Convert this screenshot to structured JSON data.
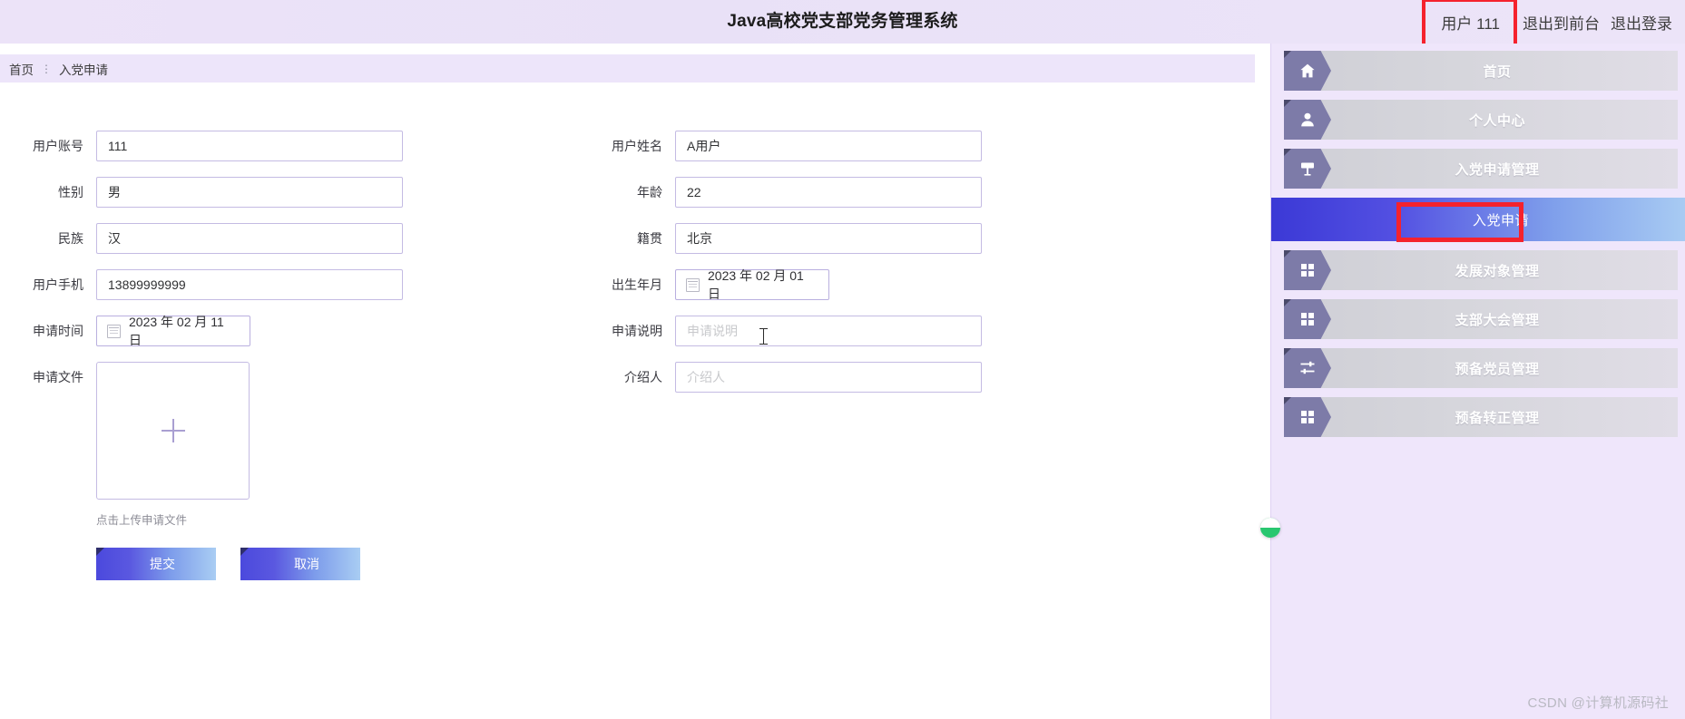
{
  "topbar": {
    "title": "Java高校党支部党务管理系统",
    "user": "用户 111",
    "exit_front": "退出到前台",
    "logout": "退出登录"
  },
  "breadcrumb": {
    "home": "首页",
    "separator": "⋮",
    "current": "入党申请"
  },
  "form": {
    "left": [
      {
        "label": "用户账号",
        "value": "111",
        "placeholder": "用户账号",
        "type": "text"
      },
      {
        "label": "性别",
        "value": "男",
        "placeholder": "性别",
        "type": "text"
      },
      {
        "label": "民族",
        "value": "汉",
        "placeholder": "民族",
        "type": "text"
      },
      {
        "label": "用户手机",
        "value": "13899999999",
        "placeholder": "用户手机",
        "type": "text"
      },
      {
        "label": "申请时间",
        "value": "2023 年 02 月 11 日",
        "type": "date"
      }
    ],
    "right": [
      {
        "label": "用户姓名",
        "value": "A用户",
        "placeholder": "用户姓名",
        "type": "text"
      },
      {
        "label": "年龄",
        "value": "22",
        "placeholder": "年龄",
        "type": "text"
      },
      {
        "label": "籍贯",
        "value": "北京",
        "placeholder": "籍贯",
        "type": "text"
      },
      {
        "label": "出生年月",
        "value": "2023 年 02 月 01 日",
        "type": "date"
      },
      {
        "label": "申请说明",
        "value": "",
        "placeholder": "申请说明",
        "type": "text"
      },
      {
        "label": "介绍人",
        "value": "",
        "placeholder": "介绍人",
        "type": "text"
      }
    ],
    "upload": {
      "label": "申请文件",
      "plus_icon": "plus-icon",
      "tip": "点击上传申请文件"
    },
    "buttons": {
      "submit": "提交",
      "cancel": "取消"
    }
  },
  "sidebar": {
    "items": [
      {
        "label": "首页",
        "icon": "home-icon",
        "active": false
      },
      {
        "label": "个人中心",
        "icon": "user-icon",
        "active": false
      },
      {
        "label": "入党申请管理",
        "icon": "flag-icon",
        "active": false
      },
      {
        "label": "入党申请",
        "icon": "none-icon",
        "active": true
      },
      {
        "label": "发展对象管理",
        "icon": "grid-icon",
        "active": false
      },
      {
        "label": "支部大会管理",
        "icon": "grid-icon",
        "active": false
      },
      {
        "label": "预备党员管理",
        "icon": "sliders-icon",
        "active": false
      },
      {
        "label": "预备转正管理",
        "icon": "grid-icon",
        "active": false
      }
    ]
  },
  "watermark": "CSDN @计算机源码社",
  "colors": {
    "accent_purple": "#8b7fd4",
    "sidebar_bg": "#efe6fb",
    "breadcrumb_bg": "#ede5fa",
    "active_blue": "#3b39d6",
    "highlight_red": "#f5222d",
    "border": "#c4bbe3",
    "green": "#28c76f"
  }
}
